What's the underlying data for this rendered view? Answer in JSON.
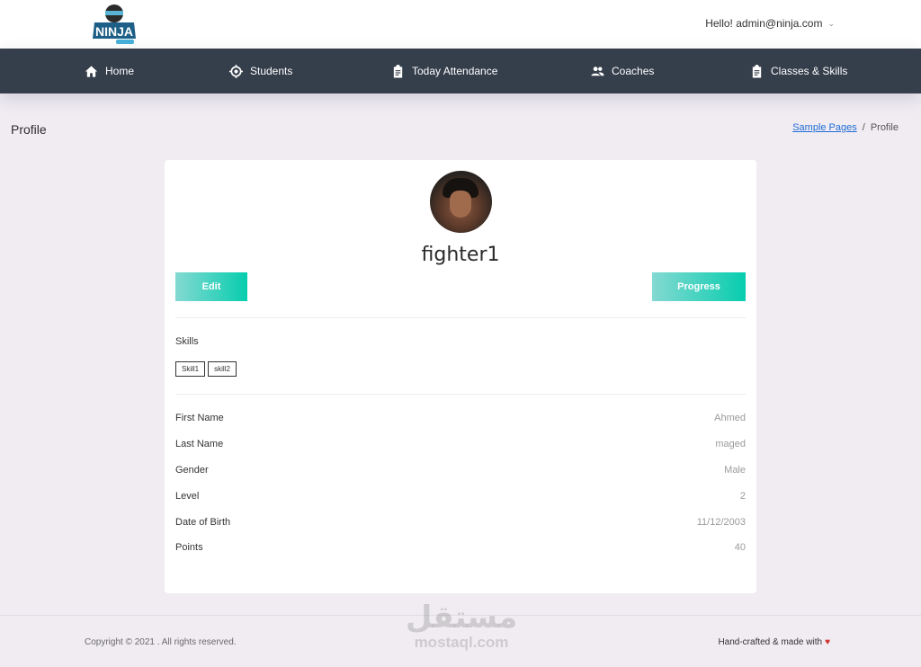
{
  "header": {
    "logo_alt": "NINJA",
    "user_greeting": "Hello! admin@ninja.com"
  },
  "nav": {
    "items": [
      {
        "label": "Home",
        "icon": "home-icon"
      },
      {
        "label": "Students",
        "icon": "crosshair-icon"
      },
      {
        "label": "Today Attendance",
        "icon": "clipboard-icon"
      },
      {
        "label": "Coaches",
        "icon": "people-icon"
      },
      {
        "label": "Classes & Skills",
        "icon": "clipboard-icon"
      }
    ]
  },
  "page": {
    "title": "Profile",
    "breadcrumb": {
      "parent": "Sample Pages",
      "separator": "/",
      "current": "Profile"
    }
  },
  "profile": {
    "username": "fighter1",
    "edit_label": "Edit",
    "progress_label": "Progress",
    "skills_label": "Skills",
    "skills": [
      "Skill1",
      "skill2"
    ],
    "fields": [
      {
        "label": "First Name",
        "value": "Ahmed"
      },
      {
        "label": "Last Name",
        "value": "maged"
      },
      {
        "label": "Gender",
        "value": "Male"
      },
      {
        "label": "Level",
        "value": "2"
      },
      {
        "label": "Date of Birth",
        "value": "11/12/2003"
      },
      {
        "label": "Points",
        "value": "40"
      }
    ]
  },
  "footer": {
    "copyright": "Copyright © 2021 . All rights reserved.",
    "crafted": "Hand-crafted & made with",
    "heart": "♥"
  },
  "watermark": {
    "arabic": "مستقل",
    "latin": "mostaql.com"
  },
  "colors": {
    "navbar": "#353e4b",
    "button_gradient_start": "#84d9d2",
    "button_gradient_end": "#07cdae",
    "page_bg": "#f0ecf2"
  }
}
